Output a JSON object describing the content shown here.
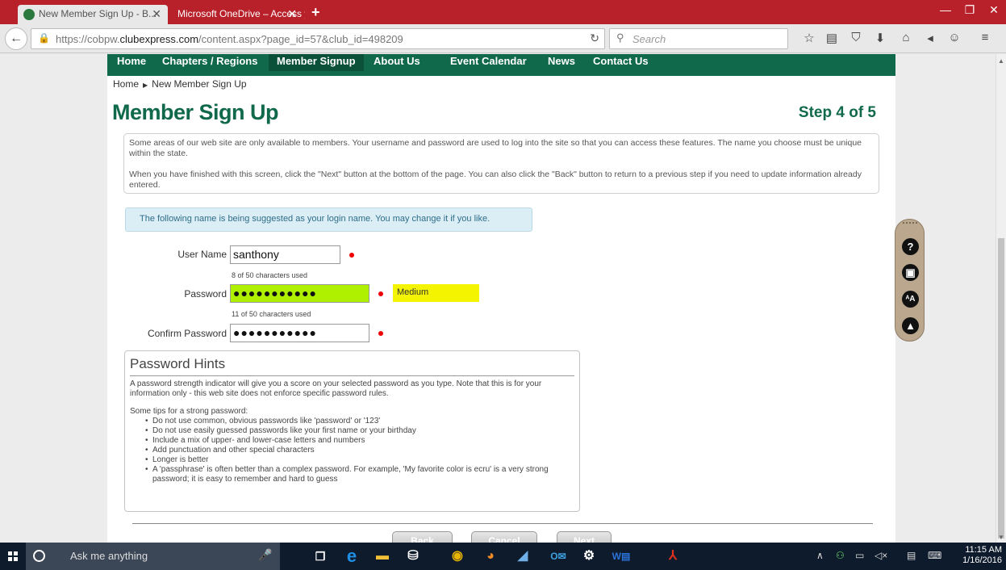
{
  "browser": {
    "tabs": [
      {
        "title": "New Member Sign Up - B..."
      },
      {
        "title": "Microsoft OneDrive – Access y..."
      }
    ],
    "new_tab": "+",
    "window_controls": {
      "minimize": "—",
      "maximize": "❐",
      "close": "✕"
    },
    "url": {
      "prefix": "https://cobpw.",
      "host": "clubexpress.com",
      "path": "/content.aspx?page_id=57&club_id=498209"
    },
    "search_placeholder": "Search",
    "toolbar_icons": [
      "star-icon",
      "reading-list-icon",
      "pocket-icon",
      "download-icon",
      "home-icon",
      "send-icon",
      "smiley-icon",
      "menu-icon"
    ]
  },
  "site_menu": {
    "items": [
      {
        "label": "Home"
      },
      {
        "label": "Chapters / Regions"
      },
      {
        "label": "Member Signup"
      },
      {
        "label": "About Us"
      },
      {
        "label": "Event Calendar"
      },
      {
        "label": "News"
      },
      {
        "label": "Contact Us"
      }
    ],
    "active_index": 2
  },
  "breadcrumb": {
    "home": "Home",
    "current": "New Member Sign Up"
  },
  "page": {
    "title": "Member Sign Up",
    "step": "Step 4 of 5",
    "intro_p1": "Some areas of our web site are only available to members. Your username and password are used to log into the site so that you can access these features. The name you choose must be unique within the state.",
    "intro_p2": "When you have finished with this screen, click the \"Next\" button at the bottom of the page. You can also click the \"Back\" button to return to a previous step if you need to update information already entered.",
    "suggestion": "The following name is being suggested as your login name. You may change it if you like."
  },
  "form": {
    "username_label": "User Name",
    "username_value": "santhony",
    "username_count": "8 of 50 characters used",
    "password_label": "Password",
    "password_mask": "●●●●●●●●●●●",
    "password_count": "11 of 50 characters used",
    "strength": "Medium",
    "confirm_label": "Confirm Password",
    "confirm_mask": "●●●●●●●●●●●"
  },
  "hints": {
    "title": "Password Hints",
    "intro": "A password strength indicator will give you a score on your selected password as you type. Note that this is for your information only - this web site does not enforce specific password rules.",
    "tips_heading": "Some tips for a strong password:",
    "tips": [
      "Do not use common, obvious passwords like 'password' or '123'",
      "Do not use easily guessed passwords like your first name or your birthday",
      "Include a mix of upper- and lower-case letters and numbers",
      "Add punctuation and other special characters",
      "Longer is better",
      "A 'passphrase' is often better than a complex password. For example, 'My favorite color is ecru' is a very strong password; it is easy to remember and hard to guess"
    ]
  },
  "buttons": {
    "back": "Back",
    "cancel": "Cancel",
    "next": "Next"
  },
  "tool_widget": [
    "help-icon",
    "print-icon",
    "text-size-icon",
    "navigate-icon"
  ],
  "taskbar": {
    "search_text": "Ask me anything",
    "time": "11:15 AM",
    "date": "1/16/2016"
  },
  "colors": {
    "brand_green": "#11694b",
    "browser_red": "#b8202a",
    "strength_yellow": "#f4f400",
    "password_green": "#aef000"
  }
}
